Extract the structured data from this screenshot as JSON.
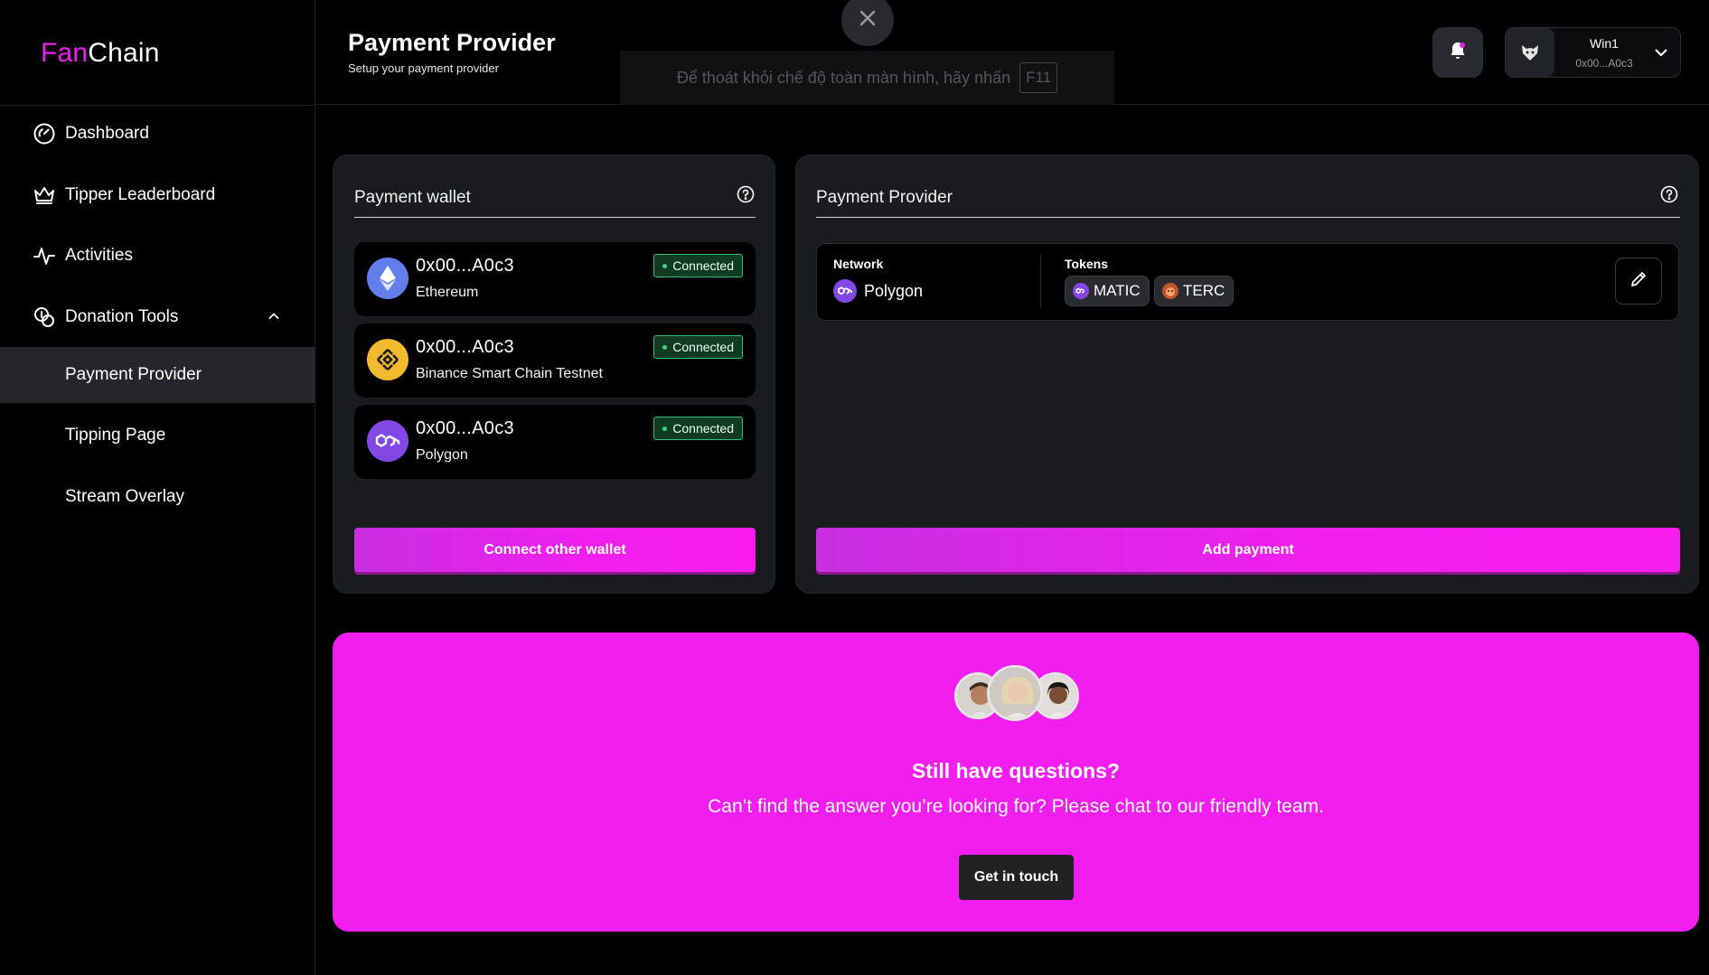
{
  "brand": {
    "fan": "Fan",
    "chain": "Chain",
    "accent": "#f21ef0"
  },
  "sidebar": {
    "items": [
      {
        "label": "Dashboard",
        "icon": "gauge-icon"
      },
      {
        "label": "Tipper Leaderboard",
        "icon": "crown-icon"
      },
      {
        "label": "Activities",
        "icon": "activity-icon"
      },
      {
        "label": "Donation Tools",
        "icon": "coins-icon",
        "expanded": true
      },
      {
        "label": "Payment Provider",
        "active": true
      },
      {
        "label": "Tipping Page"
      },
      {
        "label": "Stream Overlay"
      }
    ]
  },
  "header": {
    "title": "Payment Provider",
    "subtitle": "Setup your payment provider",
    "user": {
      "name": "Win1",
      "address": "0x00...A0c3"
    }
  },
  "fullscreen_notice": {
    "text": "Để thoát khỏi chế độ toàn màn hình, hãy nhấn",
    "key": "F11"
  },
  "wallet_card": {
    "title": "Payment wallet",
    "wallets": [
      {
        "address": "0x00...A0c3",
        "network": "Ethereum",
        "status": "Connected",
        "icon": "ethereum-icon"
      },
      {
        "address": "0x00...A0c3",
        "network": "Binance Smart Chain Testnet",
        "status": "Connected",
        "icon": "bnb-icon"
      },
      {
        "address": "0x00...A0c3",
        "network": "Polygon",
        "status": "Connected",
        "icon": "polygon-icon"
      }
    ],
    "button": "Connect other wallet"
  },
  "provider_card": {
    "title": "Payment Provider",
    "network_label": "Network",
    "network_value": "Polygon",
    "tokens_label": "Tokens",
    "tokens": [
      "MATIC",
      "TERC"
    ],
    "button": "Add payment"
  },
  "cta": {
    "title": "Still have questions?",
    "text": "Can’t find the answer you’re looking for? Please chat to our friendly team.",
    "button": "Get in touch"
  }
}
